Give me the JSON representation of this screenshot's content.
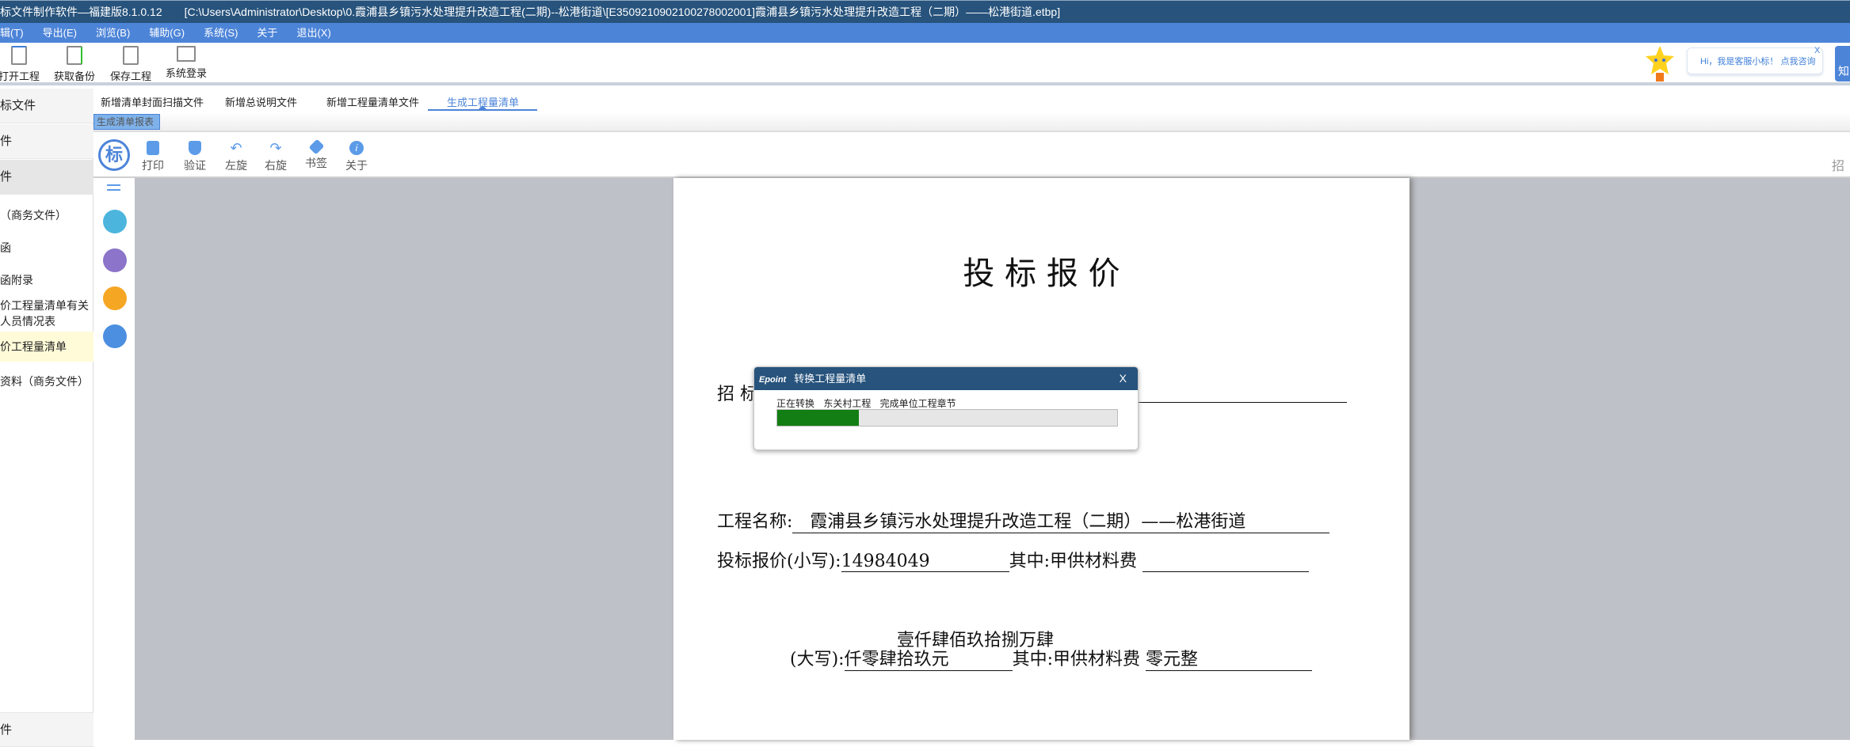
{
  "window": {
    "app_title": "标文件制作软件—福建版8.1.0.12",
    "file_path": "[C:\\Users\\Administrator\\Desktop\\0.霞浦县乡镇污水处理提升改造工程(二期)--松港街道\\[E3509210902100278002001]霞浦县乡镇污水处理提升改造工程（二期）——松港街道.etbp]"
  },
  "menu": [
    "辑(T)",
    "导出(E)",
    "浏览(B)",
    "辅助(G)",
    "系统(S)",
    "关于",
    "退出(X)"
  ],
  "toolbar": [
    {
      "label": "打开工程",
      "icon": "open-folder-icon"
    },
    {
      "label": "获取备份",
      "icon": "backup-icon"
    },
    {
      "label": "保存工程",
      "icon": "save-icon"
    },
    {
      "label": "系统登录",
      "icon": "login-icon"
    }
  ],
  "assistant": {
    "bubble": "Hi，我是客服小标！ 点我咨询",
    "close": "X",
    "button": "知"
  },
  "sidebar": {
    "headers": [
      "标文件",
      "件",
      "件"
    ],
    "items": [
      "（商务文件）",
      "函",
      "函附录",
      "价工程量清单有关",
      "人员情况表",
      "价工程量清单",
      "资料（商务文件）"
    ],
    "footer": "件",
    "selected": "价工程量清单"
  },
  "tabs": [
    "新增清单封面扫描文件",
    "新增总说明文件",
    "新增工程量清单文件",
    "生成工程量清单"
  ],
  "active_tab": "生成工程量清单",
  "subtab": "生成清单报表",
  "viewer_toolbar": {
    "logo": "标",
    "buttons": [
      "打印",
      "验证",
      "左旋",
      "右旋",
      "书签",
      "关于"
    ],
    "right_label": "招"
  },
  "side_icons": [
    "menu-icon",
    "book-icon",
    "grid-icon",
    "pencil-icon",
    "search-icon"
  ],
  "side_icon_colors": [
    "#4cb5dd",
    "#8b74c9",
    "#f5a623",
    "#4c8fe0"
  ],
  "document": {
    "title": "投 标 报 价",
    "tenderer_label": "招 标",
    "project_label": "工程名称:",
    "project_name": "霞浦县乡镇污水处理提升改造工程（二期）——松港街道",
    "price_small_label": "投标报价(小写):",
    "price_small": "14984049",
    "supply_label": "其中:甲供材料费",
    "price_big_label": "(大写):",
    "price_big_line1": "壹仟肆佰玖拾捌万肆",
    "price_big_line2": "仟零肆拾玖元",
    "supply_big": "零元整"
  },
  "dialog": {
    "brand": "Epoint",
    "title": "转换工程量清单",
    "close": "X",
    "status": "正在转换 东关村工程 完成单位工程章节",
    "progress_percent": 24,
    "progress_color": "#137e13"
  }
}
